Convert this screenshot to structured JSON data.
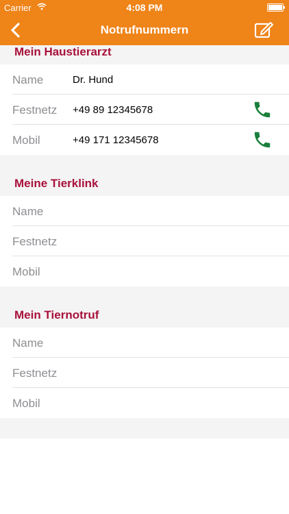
{
  "status_bar": {
    "carrier": "Carrier",
    "time": "4:08 PM"
  },
  "nav": {
    "title": "Notrufnummern",
    "back_icon": "chevron-left-icon",
    "edit_icon": "edit-icon"
  },
  "colors": {
    "accent": "#ef8419",
    "section_title": "#a8113b",
    "phone_icon": "#1a7f3c",
    "label": "#8e8e93"
  },
  "sections": [
    {
      "title": "Mein Haustierarzt",
      "rows": [
        {
          "label": "Name",
          "value": "Dr. Hund"
        },
        {
          "label": "Festnetz",
          "value": "+49 89 12345678"
        },
        {
          "label": "Mobil",
          "value": "+49 171 12345678"
        }
      ]
    },
    {
      "title": "Meine Tierklink",
      "rows": [
        {
          "label": "Name",
          "value": ""
        },
        {
          "label": "Festnetz",
          "value": ""
        },
        {
          "label": "Mobil",
          "value": ""
        }
      ]
    },
    {
      "title": "Mein Tiernotruf",
      "rows": [
        {
          "label": "Name",
          "value": ""
        },
        {
          "label": "Festnetz",
          "value": ""
        },
        {
          "label": "Mobil",
          "value": ""
        }
      ]
    }
  ]
}
